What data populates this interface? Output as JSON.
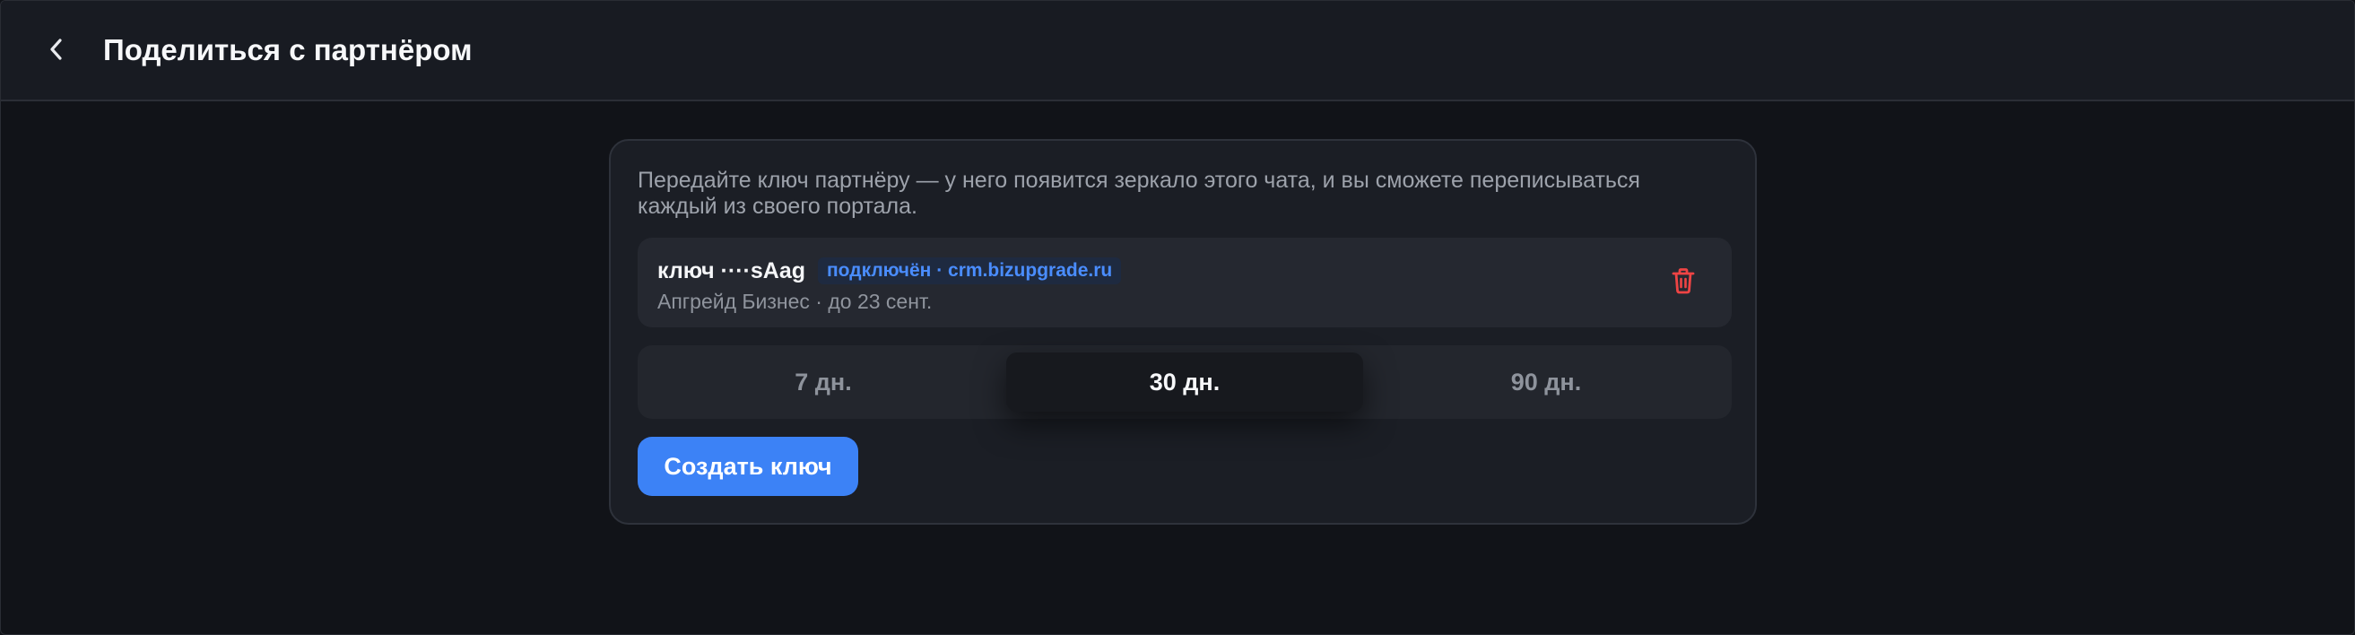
{
  "header": {
    "title": "Поделиться с партнёром",
    "back_icon": "chevron-left-icon"
  },
  "card": {
    "description": "Передайте ключ партнёру — у него появится зеркало этого чата, и вы сможете переписываться каждый из своего портала.",
    "key": {
      "label": "ключ ····sAag",
      "badge": "подключён · crm.bizupgrade.ru",
      "meta": "Апгрейд Бизнес · до 23 сент.",
      "delete_icon": "trash-icon"
    },
    "durations": [
      {
        "label": "7 дн.",
        "selected": false
      },
      {
        "label": "30 дн.",
        "selected": true
      },
      {
        "label": "90 дн.",
        "selected": false
      }
    ],
    "create_button": "Создать ключ"
  },
  "colors": {
    "background": "#111318",
    "header_bg": "#181b22",
    "card_bg": "#1b1e25",
    "accent": "#3c82f6",
    "badge_text": "#4a8dff",
    "danger": "#ef4444"
  }
}
